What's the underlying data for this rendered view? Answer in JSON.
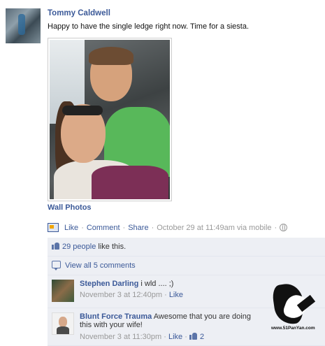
{
  "post": {
    "author": "Tommy Caldwell",
    "message": "Happy to have the single ledge right now. Time for a siesta.",
    "album": "Wall Photos",
    "actions": {
      "like": "Like",
      "comment": "Comment",
      "share": "Share",
      "timestamp": "October 29 at 11:49am via mobile",
      "sep": "·"
    }
  },
  "feedback": {
    "likes_link": "29 people",
    "likes_suffix": " like this.",
    "view_all": "View all 5 comments",
    "comments": [
      {
        "name": "Stephen Darling",
        "text": "i wld .... ;)",
        "time": "November 3 at 12:40pm",
        "like": "Like"
      },
      {
        "name": "Blunt Force Trauma",
        "text": "Awesome that you are doing this with your wife!",
        "time": "November 3 at 11:30pm",
        "like": "Like",
        "like_count": "2"
      }
    ]
  },
  "watermark": {
    "url": "www.51PanYan.com"
  }
}
